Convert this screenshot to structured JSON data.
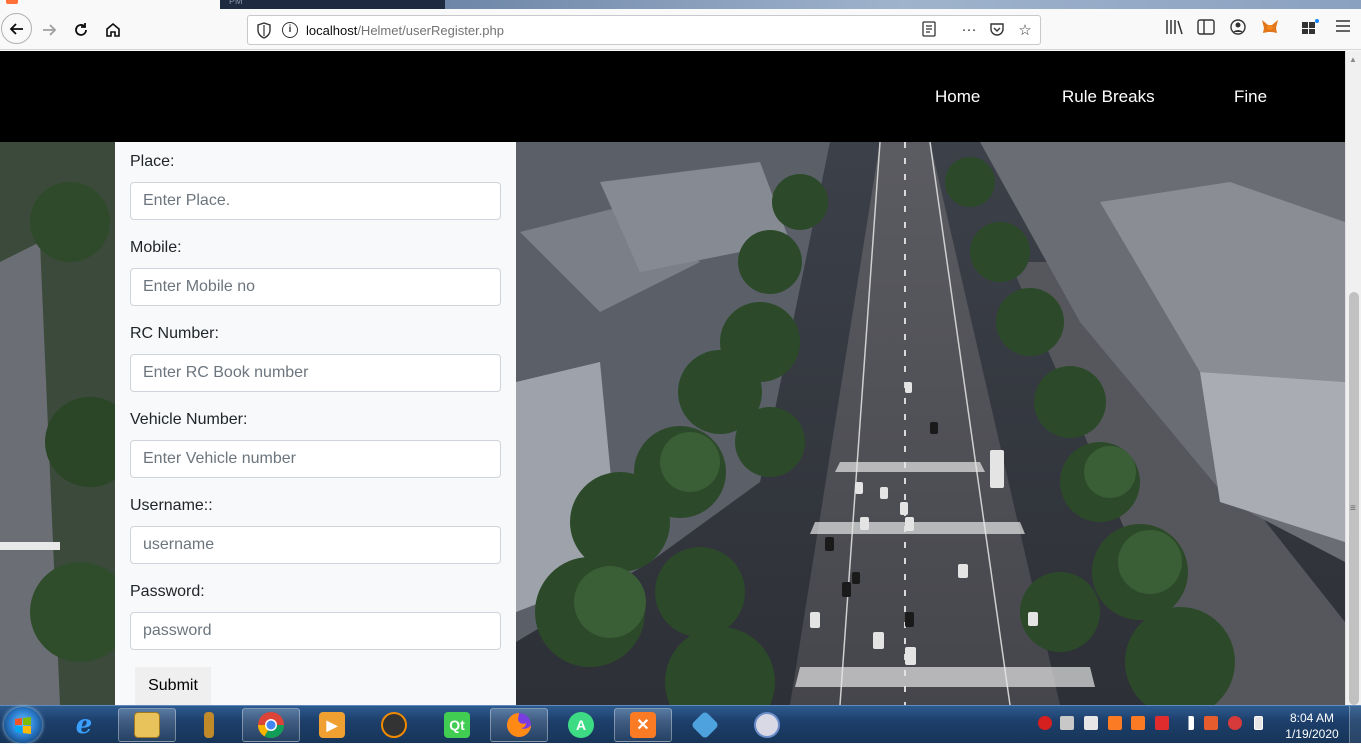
{
  "browser": {
    "other_tab_title": "PM",
    "url_host": "localhost",
    "url_path": "/Helmet/userRegister.php"
  },
  "icons": {
    "back": "back-arrow-icon",
    "forward": "forward-arrow-icon",
    "reload": "reload-icon",
    "home": "home-icon",
    "shield": "tracking-shield-icon",
    "info": "site-info-icon",
    "reader": "reader-view-icon",
    "more": "page-actions-icon",
    "pocket": "pocket-icon",
    "bookmark": "bookmark-star-icon",
    "library": "library-icon",
    "sidebar": "sidebar-icon",
    "account": "account-icon",
    "metamask": "metamask-fox-icon",
    "extensions": "extensions-icon",
    "menu": "hamburger-menu-icon"
  },
  "navbar": {
    "links": [
      "Home",
      "Rule Breaks",
      "Fine"
    ]
  },
  "form": {
    "fields": [
      {
        "label": "Place:",
        "placeholder": "Enter Place."
      },
      {
        "label": "Mobile:",
        "placeholder": "Enter Mobile no"
      },
      {
        "label": "RC Number:",
        "placeholder": "Enter RC Book number"
      },
      {
        "label": "Vehicle Number:",
        "placeholder": "Enter Vehicle number"
      },
      {
        "label": "Username::",
        "placeholder": "username"
      },
      {
        "label": "Password:",
        "placeholder": "password"
      }
    ],
    "submit_label": "Submit"
  },
  "taskbar": {
    "apps": [
      "internet-explorer",
      "file-explorer",
      "usb-tool",
      "chrome",
      "media-player",
      "vlc-like",
      "qt-creator",
      "firefox",
      "android-studio",
      "xampp",
      "virtualbox",
      "paint"
    ],
    "clock_time": "8:04 AM",
    "clock_date": "1/19/2020"
  },
  "colors": {
    "navbar_bg": "#000000",
    "form_bg": "#f8f9fa",
    "taskbar": "#1d3f6b"
  }
}
